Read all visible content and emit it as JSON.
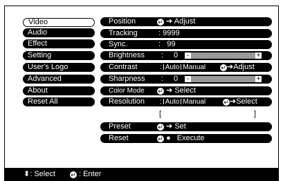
{
  "menu": [
    "Video",
    "Audio",
    "Effect",
    "Setting",
    "User's Logo",
    "Advanced",
    "About",
    "Reset All"
  ],
  "selected_menu": "Video",
  "rows": {
    "position": {
      "label": "Position",
      "value": "Adjust"
    },
    "tracking": {
      "label": "Tracking",
      "value": ": 9999"
    },
    "sync": {
      "label": "Sync.",
      "value": ":   99"
    },
    "brightness": {
      "label": "Brightness",
      "colon": ":",
      "value": "0",
      "minus": "-",
      "plus": "+"
    },
    "contrast": {
      "label": "Contrast",
      "colon": ":",
      "opt1": "Auto",
      "opt2": "Manual",
      "action": "Adjust"
    },
    "sharpness": {
      "label": "Sharpness",
      "colon": ":",
      "value": "0",
      "minus": "-",
      "plus": "+"
    },
    "color_mode": {
      "label": "Color Mode",
      "value": "Select"
    },
    "resolution": {
      "label": "Resolution",
      "colon": ":",
      "opt1": "Auto",
      "opt2": "Manual",
      "action": "Select",
      "bracket_open": "[",
      "bracket_close": "]"
    },
    "preset": {
      "label": "Preset",
      "value": "Set"
    },
    "reset": {
      "label": "Reset",
      "value": "Execute"
    }
  },
  "footer": {
    "select_label": ": Select",
    "enter_label": ": Enter"
  },
  "icons": {
    "enter": "enter-icon",
    "arrow": "right-arrow-icon",
    "updown": "up-down-icon",
    "execute": "execute-icon"
  }
}
